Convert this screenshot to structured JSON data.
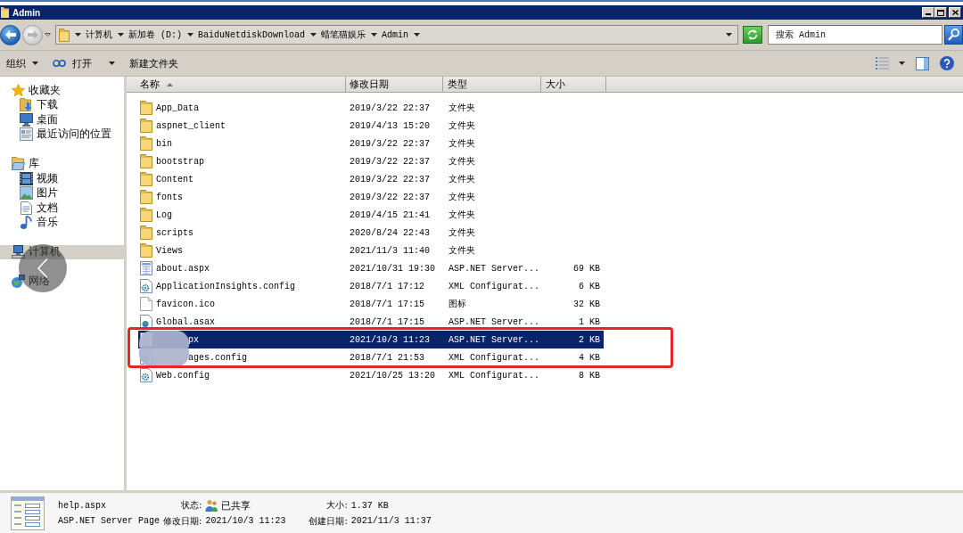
{
  "window": {
    "title": "Admin"
  },
  "navigation": {
    "back": {
      "disabled": false
    },
    "forward": {
      "disabled": true
    }
  },
  "address_bar": {
    "breadcrumbs": [
      "计算机",
      "新加卷 (D:)",
      "BaiduNetdiskDownload",
      "蜡笔猫娱乐",
      "Admin"
    ]
  },
  "search": {
    "placeholder": "搜索 Admin"
  },
  "toolbar": {
    "items": [
      {
        "label": "组织",
        "kind": "menu"
      },
      {
        "label": "打开",
        "kind": "open"
      },
      {
        "label": "新建文件夹",
        "kind": "plain"
      }
    ]
  },
  "sidebar": {
    "items": [
      {
        "label": "收藏夹",
        "selected": false,
        "children": [
          {
            "label": "下载",
            "selected": false
          },
          {
            "label": "桌面",
            "selected": false
          },
          {
            "label": "最近访问的位置",
            "selected": false
          }
        ]
      },
      {
        "label": "库",
        "selected": false,
        "children": [
          {
            "label": "视频",
            "selected": false
          },
          {
            "label": "图片",
            "selected": false
          },
          {
            "label": "文档",
            "selected": false
          },
          {
            "label": "音乐",
            "selected": false
          }
        ]
      },
      {
        "label": "计算机",
        "selected": true
      },
      {
        "label": "网络",
        "selected": false
      }
    ]
  },
  "file_list": {
    "columns": [
      {
        "label": "名称",
        "sorted": true
      },
      {
        "label": "修改日期",
        "sorted": false
      },
      {
        "label": "类型",
        "sorted": false
      },
      {
        "label": "大小",
        "sorted": false
      }
    ],
    "rows": [
      {
        "name": "App_Data",
        "modified": "2019/3/22 22:37",
        "type": "文件夹",
        "kind": "folder",
        "selected": false,
        "redacted": false,
        "highlighted": false
      },
      {
        "name": "aspnet_client",
        "modified": "2019/4/13 15:20",
        "type": "文件夹",
        "kind": "folder",
        "selected": false,
        "redacted": false,
        "highlighted": false
      },
      {
        "name": "bin",
        "modified": "2019/3/22 22:37",
        "type": "文件夹",
        "kind": "folder",
        "selected": false,
        "redacted": false,
        "highlighted": false
      },
      {
        "name": "bootstrap",
        "modified": "2019/3/22 22:37",
        "type": "文件夹",
        "kind": "folder",
        "selected": false,
        "redacted": false,
        "highlighted": false
      },
      {
        "name": "Content",
        "modified": "2019/3/22 22:37",
        "type": "文件夹",
        "kind": "folder",
        "selected": false,
        "redacted": false,
        "highlighted": false
      },
      {
        "name": "fonts",
        "modified": "2019/3/22 22:37",
        "type": "文件夹",
        "kind": "folder",
        "selected": false,
        "redacted": false,
        "highlighted": false
      },
      {
        "name": "Log",
        "modified": "2019/4/15 21:41",
        "type": "文件夹",
        "kind": "folder",
        "selected": false,
        "redacted": false,
        "highlighted": false
      },
      {
        "name": "scripts",
        "modified": "2020/8/24 22:43",
        "type": "文件夹",
        "kind": "folder",
        "selected": false,
        "redacted": false,
        "highlighted": false
      },
      {
        "name": "Views",
        "modified": "2021/11/3 11:40",
        "type": "文件夹",
        "kind": "folder",
        "selected": false,
        "redacted": false,
        "highlighted": false
      },
      {
        "name": "about.aspx",
        "modified": "2021/10/31 19:30",
        "type": "ASP.NET Server...",
        "size": "69 KB",
        "kind": "aspx",
        "selected": false,
        "redacted": false,
        "highlighted": false
      },
      {
        "name": "ApplicationInsights.config",
        "modified": "2018/7/1 17:12",
        "type": "XML Configurat...",
        "size": "6 KB",
        "kind": "config",
        "selected": false,
        "redacted": false,
        "highlighted": false
      },
      {
        "name": "favicon.ico",
        "modified": "2018/7/1 17:15",
        "type": "图标",
        "size": "32 KB",
        "kind": "ico",
        "selected": false,
        "redacted": false,
        "highlighted": false
      },
      {
        "name": "Global.asax",
        "modified": "2018/7/1 17:15",
        "type": "ASP.NET Server...",
        "size": "1 KB",
        "kind": "asax",
        "selected": false,
        "redacted": false,
        "highlighted": false
      },
      {
        "name": "px",
        "modified": "2021/10/3 11:23",
        "type": "ASP.NET Server...",
        "size": "2 KB",
        "kind": "aspx",
        "selected": true,
        "redacted": true,
        "highlighted": true
      },
      {
        "name": "ages.config",
        "modified": "2018/7/1 21:53",
        "type": "XML Configurat...",
        "size": "4 KB",
        "kind": "config",
        "selected": false,
        "redacted": true,
        "highlighted": true
      },
      {
        "name": "Web.config",
        "modified": "2021/10/25 13:20",
        "type": "XML Configurat...",
        "size": "8 KB",
        "kind": "config",
        "selected": false,
        "redacted": false,
        "highlighted": false
      }
    ]
  },
  "details_pane": {
    "name": "help.aspx",
    "type": "ASP.NET Server Page",
    "fields": [
      {
        "label": "状态:",
        "value": "已共享",
        "kind": "shared"
      },
      {
        "label": "大小:",
        "value": "1.37 KB",
        "kind": "text"
      },
      {
        "label": "修改日期:",
        "value": "2021/10/3 11:23",
        "kind": "text"
      },
      {
        "label": "创建日期:",
        "value": "2021/11/3 11:37",
        "kind": "text"
      }
    ]
  }
}
